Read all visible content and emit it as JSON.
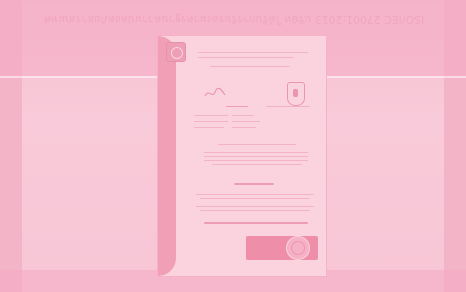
{
  "banner": {
    "mirrored_text": "ISO/IEC 27001:2013 บริษัท ได้รับการรับรองมาตรฐานความปลอดภัยสารสนเทศ"
  },
  "colors": {
    "overlay": "#f7c3d3",
    "accent": "#ef8ea8"
  },
  "icons": {
    "top_left_logo": "certification-body-logo",
    "crest": "crest-icon",
    "seal": "accreditation-seal",
    "signature": "signature"
  }
}
